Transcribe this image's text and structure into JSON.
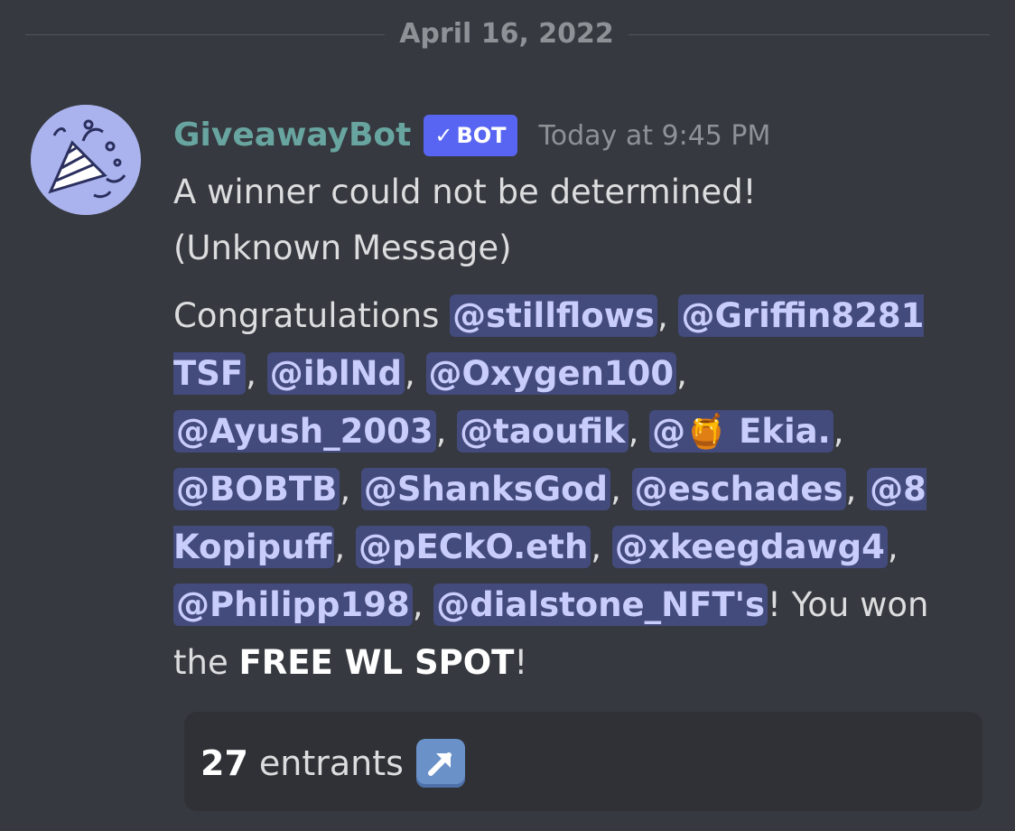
{
  "date_divider": "April 16, 2022",
  "message": {
    "author": "GiveawayBot",
    "bot_badge": "BOT",
    "timestamp": "Today at 9:45 PM",
    "line1": "A winner could not be determined!",
    "line2": "(Unknown Message)",
    "congrats_prefix": "Congratulations ",
    "mentions": [
      "@stillflows",
      "@Griffin8281 TSF",
      "@iblNd",
      "@Oxygen100",
      "@Ayush_2003",
      "@taoufik",
      "@🍯 Ekia.",
      "@BOBTB",
      "@ShanksGod",
      "@eschades",
      "@8 Kopipuff",
      "@pECkO.eth",
      "@xkeegdawg4",
      "@Philipp198",
      "@dialstone_NFT's"
    ],
    "separator": ", ",
    "won_prefix": "! You won the ",
    "prize": "FREE WL SPOT",
    "suffix": "!"
  },
  "embed": {
    "entrant_count": "27",
    "entrants_label": "entrants",
    "arrow_icon": "up-right-arrow-icon"
  },
  "colors": {
    "background": "#36393f",
    "username": "#68a5a0",
    "badge": "#5865f2",
    "mention_bg": "#434a7c",
    "mention_text": "#c9cdfb"
  }
}
